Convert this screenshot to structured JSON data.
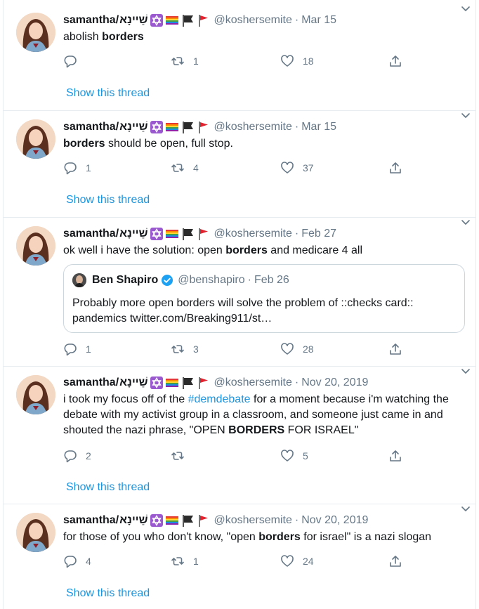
{
  "colors": {
    "link": "#1b95e0",
    "secondary": "#657786",
    "border": "#e6ecf0"
  },
  "tweets": [
    {
      "name": "samantha/",
      "hebrew": "שֵׁיינָא",
      "emojis": [
        "star-of-david-emoji",
        "rainbow-flag-emoji",
        "black-flag-emoji",
        "red-flag-emoji"
      ],
      "handle": "@koshersemite",
      "separator": "·",
      "date": "Mar 15",
      "text_parts": [
        {
          "t": "abolish "
        },
        {
          "t": "borders",
          "bold": true
        }
      ],
      "reply": "",
      "retweet": "1",
      "like": "18",
      "show_thread": "Show this thread"
    },
    {
      "name": "samantha/",
      "hebrew": "שֵׁיינָא",
      "emojis": [
        "star-of-david-emoji",
        "rainbow-flag-emoji",
        "black-flag-emoji",
        "red-flag-emoji"
      ],
      "handle": "@koshersemite",
      "separator": "·",
      "date": "Mar 15",
      "text_parts": [
        {
          "t": "borders",
          "bold": true
        },
        {
          "t": " should be open, full stop."
        }
      ],
      "reply": "1",
      "retweet": "4",
      "like": "37",
      "show_thread": "Show this thread"
    },
    {
      "name": "samantha/",
      "hebrew": "שֵׁיינָא",
      "emojis": [
        "star-of-david-emoji",
        "rainbow-flag-emoji",
        "black-flag-emoji",
        "red-flag-emoji"
      ],
      "handle": "@koshersemite",
      "separator": "·",
      "date": "Feb 27",
      "text_parts": [
        {
          "t": "ok well i have the solution: open "
        },
        {
          "t": "borders",
          "bold": true
        },
        {
          "t": " and medicare 4 all"
        }
      ],
      "quote": {
        "name": "Ben Shapiro",
        "handle": "@benshapiro",
        "separator": "·",
        "date": "Feb 26",
        "text": "Probably more open borders will solve the problem of ::checks card:: pandemics twitter.com/Breaking911/st…"
      },
      "reply": "1",
      "retweet": "3",
      "like": "28"
    },
    {
      "name": "samantha/",
      "hebrew": "שֵׁיינָא",
      "emojis": [
        "star-of-david-emoji",
        "rainbow-flag-emoji",
        "black-flag-emoji",
        "red-flag-emoji"
      ],
      "handle": "@koshersemite",
      "separator": "·",
      "date": "Nov 20, 2019",
      "text_parts": [
        {
          "t": "i took my focus off of the "
        },
        {
          "t": "#demdebate",
          "hashtag": true
        },
        {
          "t": " for a moment because i'm watching the debate with my activist group in a classroom, and someone just came in and shouted the nazi phrase, \"OPEN "
        },
        {
          "t": "BORDERS",
          "bold": true
        },
        {
          "t": " FOR ISRAEL\""
        }
      ],
      "reply": "2",
      "retweet": "",
      "like": "5",
      "show_thread": "Show this thread"
    },
    {
      "name": "samantha/",
      "hebrew": "שֵׁיינָא",
      "emojis": [
        "star-of-david-emoji",
        "rainbow-flag-emoji",
        "black-flag-emoji",
        "red-flag-emoji"
      ],
      "handle": "@koshersemite",
      "separator": "·",
      "date": "Nov 20, 2019",
      "text_parts": [
        {
          "t": "for those of you who don't know, \"open "
        },
        {
          "t": "borders",
          "bold": true
        },
        {
          "t": " for israel\" is a nazi slogan"
        }
      ],
      "reply": "4",
      "retweet": "1",
      "like": "24",
      "show_thread": "Show this thread"
    }
  ]
}
